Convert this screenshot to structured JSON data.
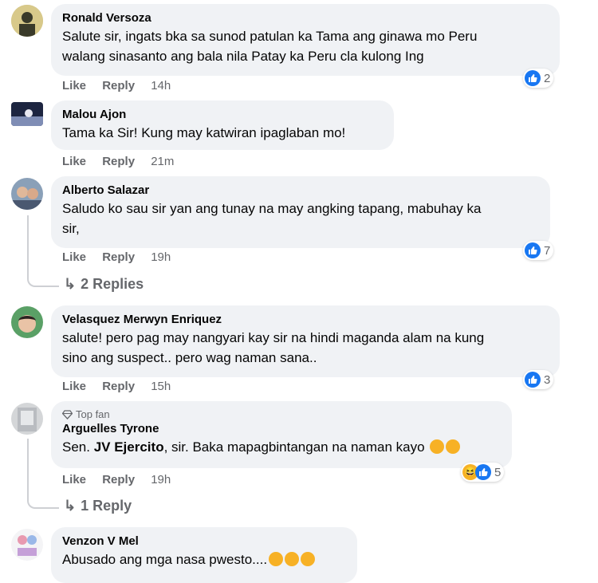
{
  "comments": [
    {
      "author": "Ronald Versoza",
      "line1": "Salute sir, ingats bka sa sunod patulan ka Tama ang ginawa mo Peru",
      "line2": "walang sinasanto ang bala nila Patay ka Peru cla kulong Ing",
      "like": "Like",
      "reply": "Reply",
      "time": "14h",
      "reactions": "2"
    },
    {
      "author": "Malou Ajon",
      "line1": "Tama ka Sir! Kung may katwiran ipaglaban mo!",
      "like": "Like",
      "reply": "Reply",
      "time": "21m"
    },
    {
      "author": "Alberto Salazar",
      "line1": "Saludo ko sau sir yan ang tunay na may angking tapang, mabuhay ka",
      "line2": "sir,",
      "like": "Like",
      "reply": "Reply",
      "time": "19h",
      "reactions": "7",
      "replies": "2 Replies"
    },
    {
      "author": "Velasquez Merwyn Enriquez",
      "line1": "salute! pero pag may nangyari kay sir na hindi maganda alam na kung",
      "line2": "sino ang suspect.. pero wag naman sana..",
      "like": "Like",
      "reply": "Reply",
      "time": "15h",
      "reactions": "3"
    },
    {
      "badge": "Top fan",
      "author": "Arguelles Tyrone",
      "prefix": "Sen. ",
      "mention": "JV Ejercito",
      "line1": ", sir. Baka mapagbintangan na naman kayo",
      "like": "Like",
      "reply": "Reply",
      "time": "19h",
      "reactions": "5",
      "replies": "1 Reply"
    },
    {
      "author": "Venzon V Mel",
      "line1": "Abusado ang mga nasa pwesto...."
    }
  ],
  "colors": {
    "like_blue": "#1877f2",
    "bubble": "#f0f2f5",
    "meta": "#65676b"
  },
  "icons": {
    "like": "thumbs-up-icon",
    "haha": "haha-emoji-icon",
    "reply_arrow": "reply-arrow-icon",
    "topfan": "diamond-badge-icon"
  }
}
